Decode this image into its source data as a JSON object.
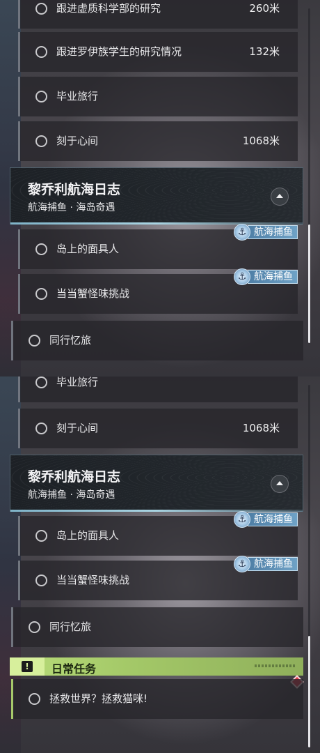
{
  "panel_top": {
    "tasks_before": [
      {
        "label": "跟进虚质科学部的研究",
        "distance": "260米"
      },
      {
        "label": "跟进罗伊族学生的研究情况",
        "distance": "132米"
      },
      {
        "label": "毕业旅行",
        "distance": ""
      },
      {
        "label": "刻于心间",
        "distance": "1068米"
      }
    ],
    "group": {
      "title": "黎乔利航海日志",
      "subtitle": "航海捕鱼 · 海岛奇遇"
    },
    "group_tasks": [
      {
        "label": "岛上的面具人",
        "badge": "航海捕鱼"
      },
      {
        "label": "当当蟹怪味挑战",
        "badge": "航海捕鱼"
      }
    ],
    "outer_task": {
      "label": "同行忆旅"
    }
  },
  "panel_bottom": {
    "tasks_before": [
      {
        "label": "毕业旅行",
        "distance": ""
      },
      {
        "label": "刻于心间",
        "distance": "1068米"
      }
    ],
    "group": {
      "title": "黎乔利航海日志",
      "subtitle": "航海捕鱼 · 海岛奇遇"
    },
    "group_tasks": [
      {
        "label": "岛上的面具人",
        "badge": "航海捕鱼"
      },
      {
        "label": "当当蟹怪味挑战",
        "badge": "航海捕鱼"
      }
    ],
    "outer_task": {
      "label": "同行忆旅"
    },
    "daily": {
      "header_label": "日常任务",
      "header_icon": "!",
      "task": {
        "label": "拯救世界？拯救猫咪!"
      }
    }
  },
  "icons": {
    "task_status": "circle-outline-icon",
    "collapse": "chevron-up-icon",
    "badge": "anchor-icon",
    "daily": "exclamation-icon",
    "new_marker": "diamond-icon"
  },
  "colors": {
    "daily_accent": "#a6c86a",
    "badge_blue": "#6fa2c6",
    "header_border": "#7fb3c8",
    "new_marker": "#e03a48"
  }
}
